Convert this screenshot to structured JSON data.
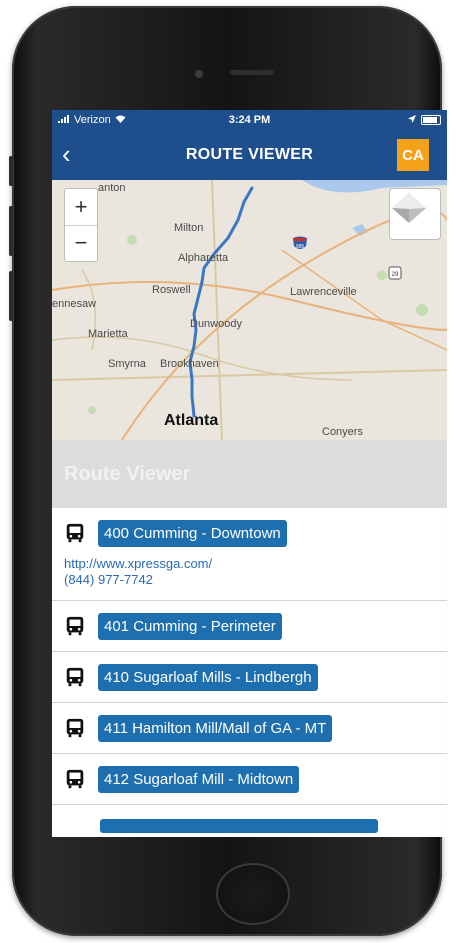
{
  "status_bar": {
    "carrier": "Verizon",
    "time": "3:24 PM"
  },
  "nav": {
    "back_label": "‹",
    "title": "ROUTE VIEWER",
    "badge": "CA"
  },
  "map": {
    "zoom_in": "+",
    "zoom_out": "−",
    "labels": [
      "anton",
      "Milton",
      "Alpharetta",
      "Roswell",
      "Lawrenceville",
      "ennesaw",
      "Marietta",
      "Dunwoody",
      "Smyrna",
      "Brookhaven",
      "Atlanta",
      "Conyers"
    ],
    "shields": {
      "interstate": "985",
      "us": "29"
    }
  },
  "section": {
    "title": "Route Viewer"
  },
  "routes": [
    {
      "name": "400 Cumming - Downtown",
      "link": "http://www.xpressga.com/",
      "phone": "(844) 977-7742"
    },
    {
      "name": "401 Cumming - Perimeter"
    },
    {
      "name": "410 Sugarloaf Mills - Lindbergh"
    },
    {
      "name": "411 Hamilton Mill/Mall of GA - MT"
    },
    {
      "name": "412 Sugarloaf Mill - Midtown"
    }
  ],
  "colors": {
    "nav_blue": "#1f4e8c",
    "pill_blue": "#1e6fb0",
    "badge_orange": "#f4a21a",
    "route_line": "#3a78c2"
  }
}
